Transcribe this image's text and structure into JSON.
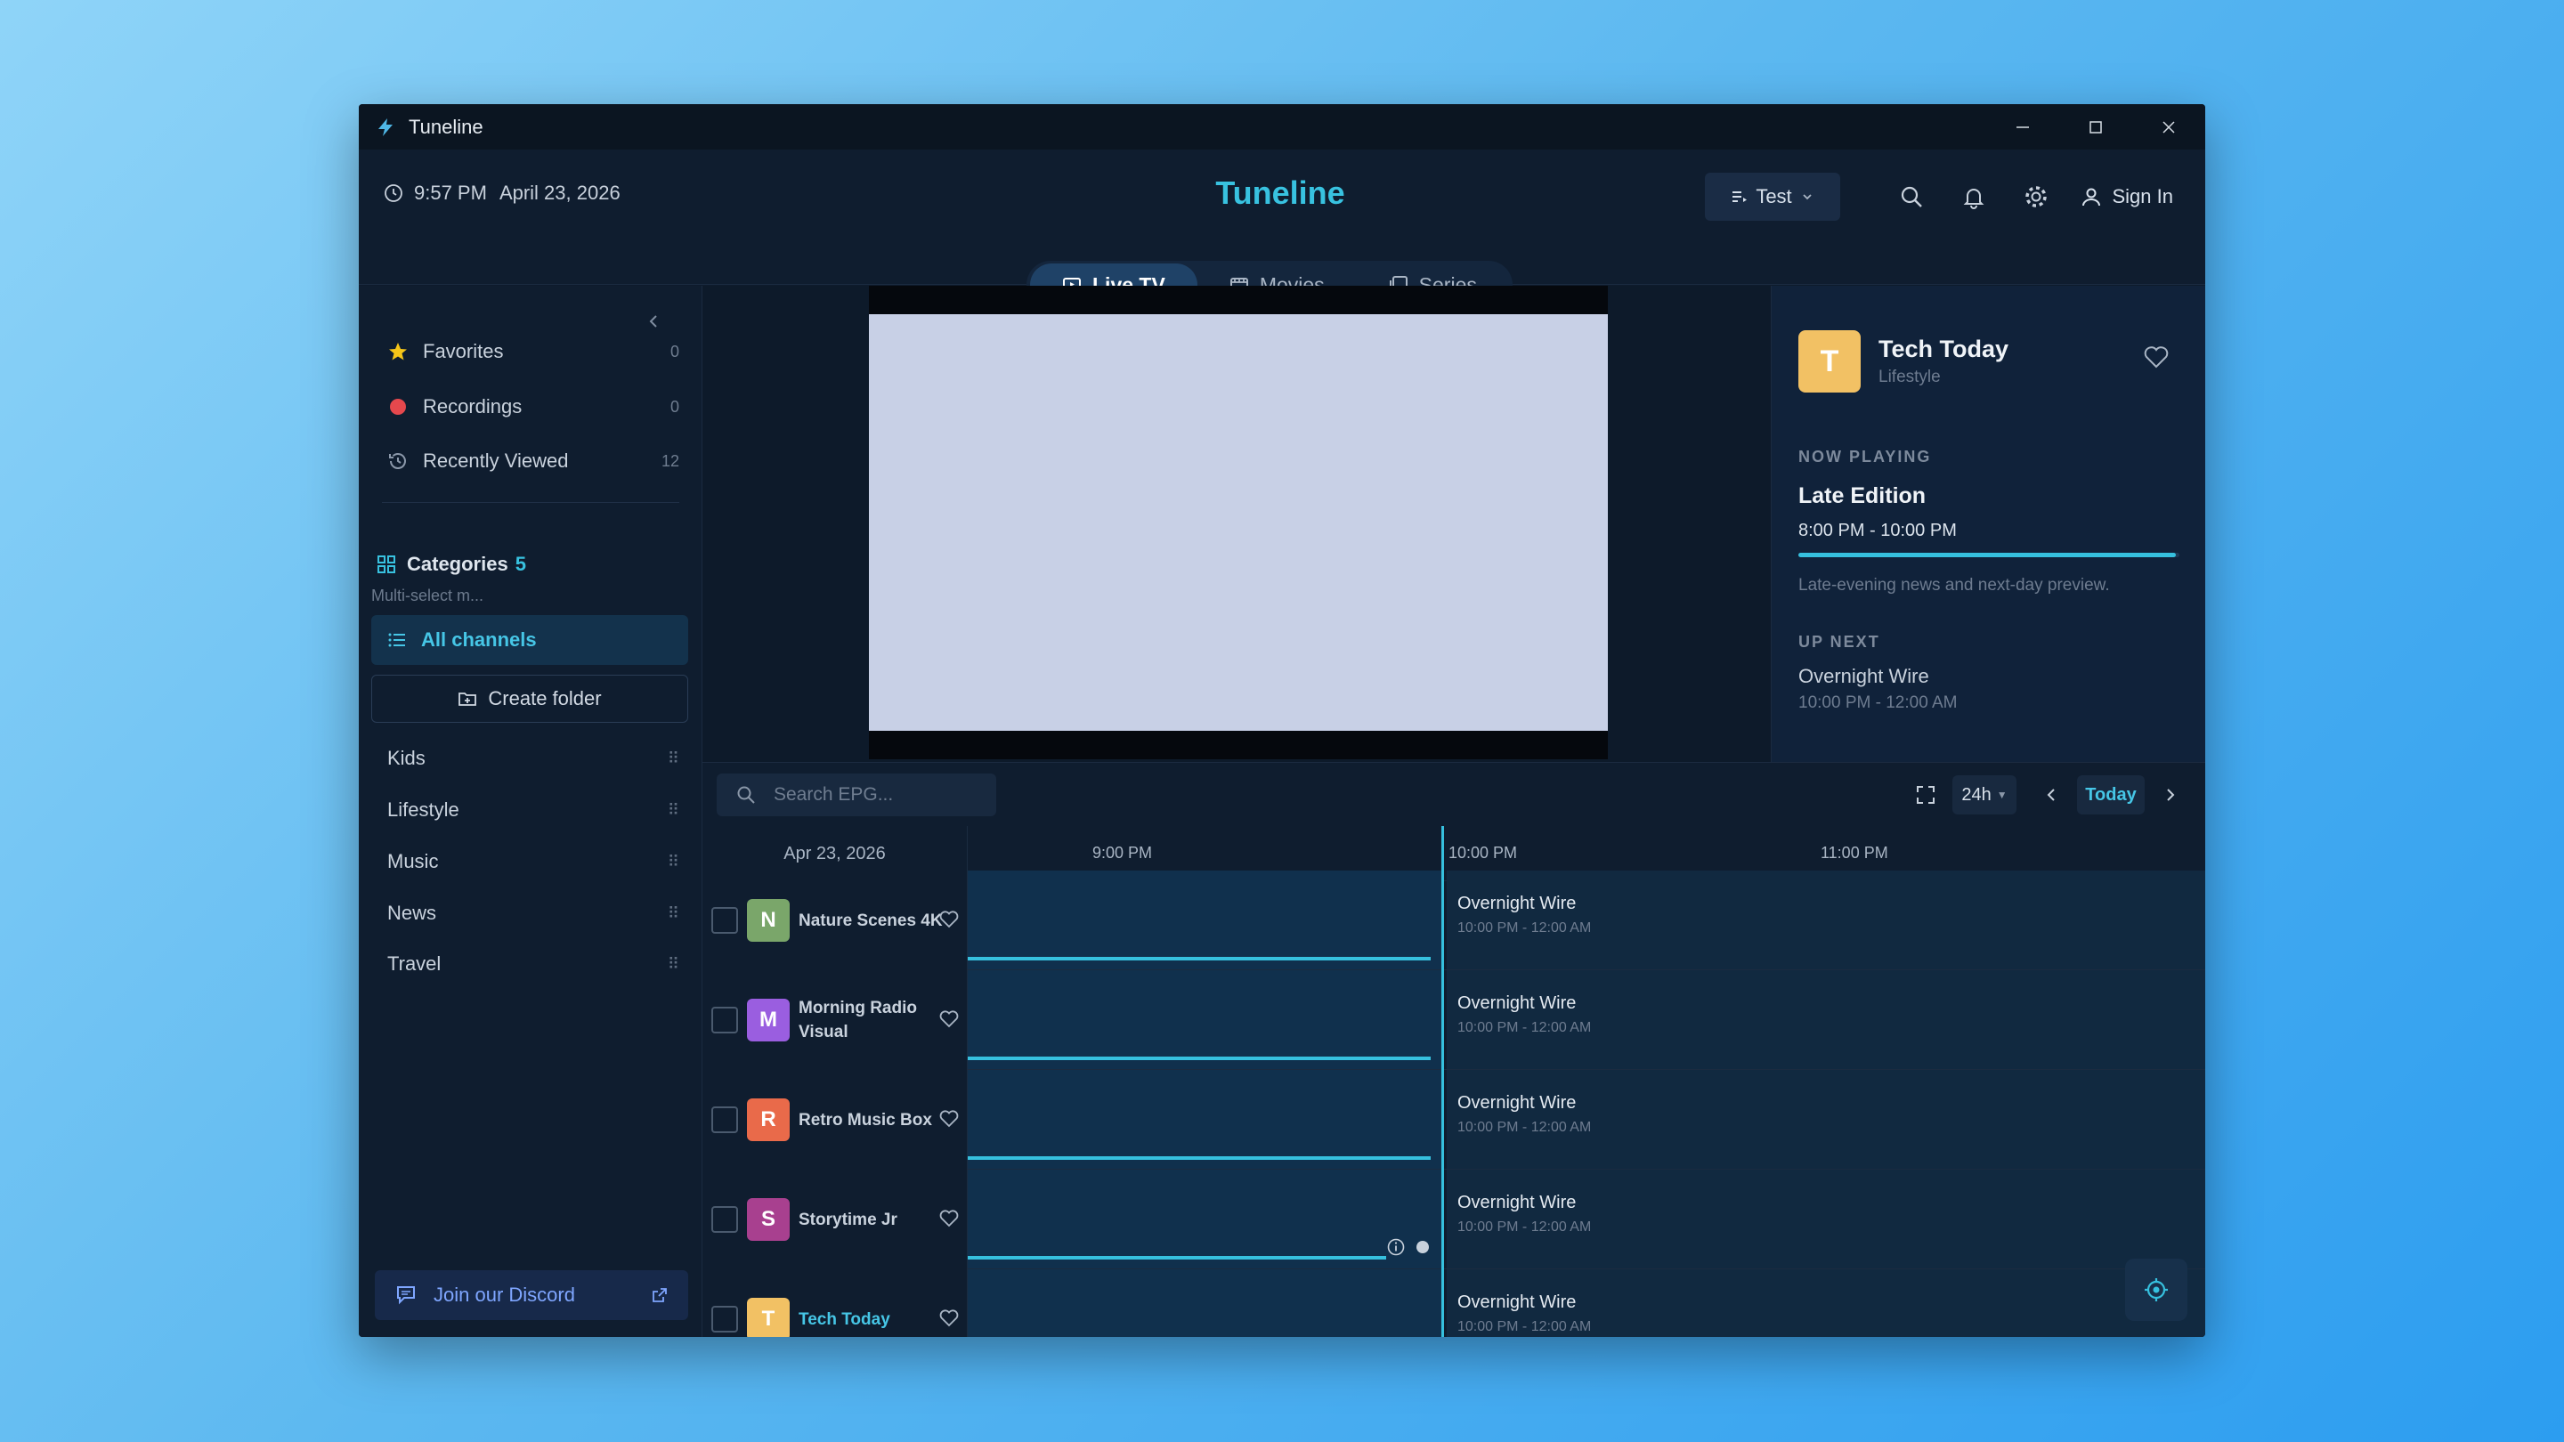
{
  "window": {
    "title": "Tuneline",
    "minimize": "─",
    "maximize": "☐",
    "close": "✕"
  },
  "header": {
    "time": "9:57 PM",
    "date": "April 23, 2026",
    "app_name": "Tuneline",
    "profile": "Test",
    "sign_in": "Sign In"
  },
  "tabs": [
    {
      "label": "Live TV",
      "active": true
    },
    {
      "label": "Movies",
      "active": false
    },
    {
      "label": "Series",
      "active": false
    }
  ],
  "sidebar": {
    "quick": [
      {
        "label": "Favorites",
        "count": "0"
      },
      {
        "label": "Recordings",
        "count": "0"
      },
      {
        "label": "Recently Viewed",
        "count": "12"
      }
    ],
    "categories_label": "Categories",
    "categories_count": "5",
    "categories_hint": "Multi-select m...",
    "all_channels": "All channels",
    "create_folder": "Create folder",
    "categories": [
      "Kids",
      "Lifestyle",
      "Music",
      "News",
      "Travel"
    ],
    "discord": "Join our Discord"
  },
  "info": {
    "avatar_letter": "T",
    "channel": "Tech Today",
    "category": "Lifestyle",
    "now_playing_label": "NOW PLAYING",
    "now_title": "Late Edition",
    "now_time": "8:00 PM - 10:00 PM",
    "progress": 0.99,
    "now_desc": "Late-evening news and next-day preview.",
    "up_next_label": "UP NEXT",
    "next_title": "Overnight Wire",
    "next_time": "10:00 PM - 12:00 AM"
  },
  "epg": {
    "search_placeholder": "Search EPG...",
    "range": "24h",
    "today": "Today",
    "date": "Apr 23, 2026",
    "ticks": [
      "9:00 PM",
      "10:00 PM",
      "11:00 PM"
    ],
    "rows": [
      {
        "letter": "N",
        "color": "#7aa66a",
        "name": "Nature Scenes 4K",
        "next_title": "Overnight Wire",
        "next_time": "10:00 PM - 12:00 AM"
      },
      {
        "letter": "M",
        "color": "#9a5ee0",
        "name": "Morning Radio Visual",
        "next_title": "Overnight Wire",
        "next_time": "10:00 PM - 12:00 AM"
      },
      {
        "letter": "R",
        "color": "#e96a4a",
        "name": "Retro Music Box",
        "next_title": "Overnight Wire",
        "next_time": "10:00 PM - 12:00 AM"
      },
      {
        "letter": "S",
        "color": "#a8408f",
        "name": "Storytime Jr",
        "next_title": "Overnight Wire",
        "next_time": "10:00 PM - 12:00 AM"
      },
      {
        "letter": "T",
        "color": "#f2c164",
        "name": "Tech Today",
        "next_title": "Overnight Wire",
        "next_time": "10:00 PM - 12:00 AM"
      }
    ]
  },
  "colors": {
    "accent": "#36c0de",
    "bg": "#0e1b2c",
    "favorite": "#f5c518",
    "record": "#e5484d"
  }
}
